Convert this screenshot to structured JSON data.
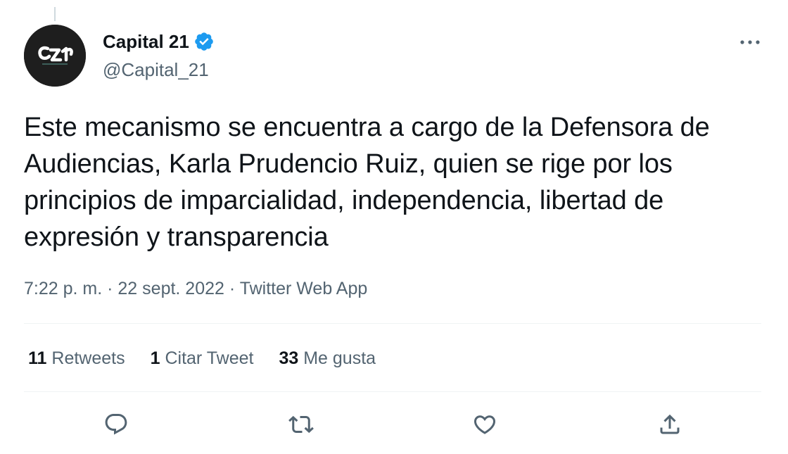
{
  "author": {
    "display_name": "Capital 21",
    "handle": "@Capital_21",
    "verified": true
  },
  "tweet": {
    "text": "Este mecanismo se encuentra a cargo de la Defensora de Audiencias, Karla Prudencio Ruiz, quien se rige por los principios de imparcialidad, independencia, libertad de expresión y transparencia",
    "time": "7:22 p. m.",
    "separator": "·",
    "date": "22 sept. 2022",
    "source": "Twitter Web App"
  },
  "stats": {
    "retweets": {
      "count": "11",
      "label": "Retweets"
    },
    "quotes": {
      "count": "1",
      "label": "Citar Tweet"
    },
    "likes": {
      "count": "33",
      "label": "Me gusta"
    }
  },
  "icons": {
    "reply": "reply-icon",
    "retweet": "retweet-icon",
    "like": "heart-icon",
    "share": "share-icon",
    "more": "more-icon",
    "verified": "verified-badge-icon"
  },
  "colors": {
    "text": "#0f1419",
    "secondary": "#536471",
    "verified": "#1d9bf0",
    "divider": "#eff3f4",
    "avatar_bg": "#1e1e1e"
  }
}
